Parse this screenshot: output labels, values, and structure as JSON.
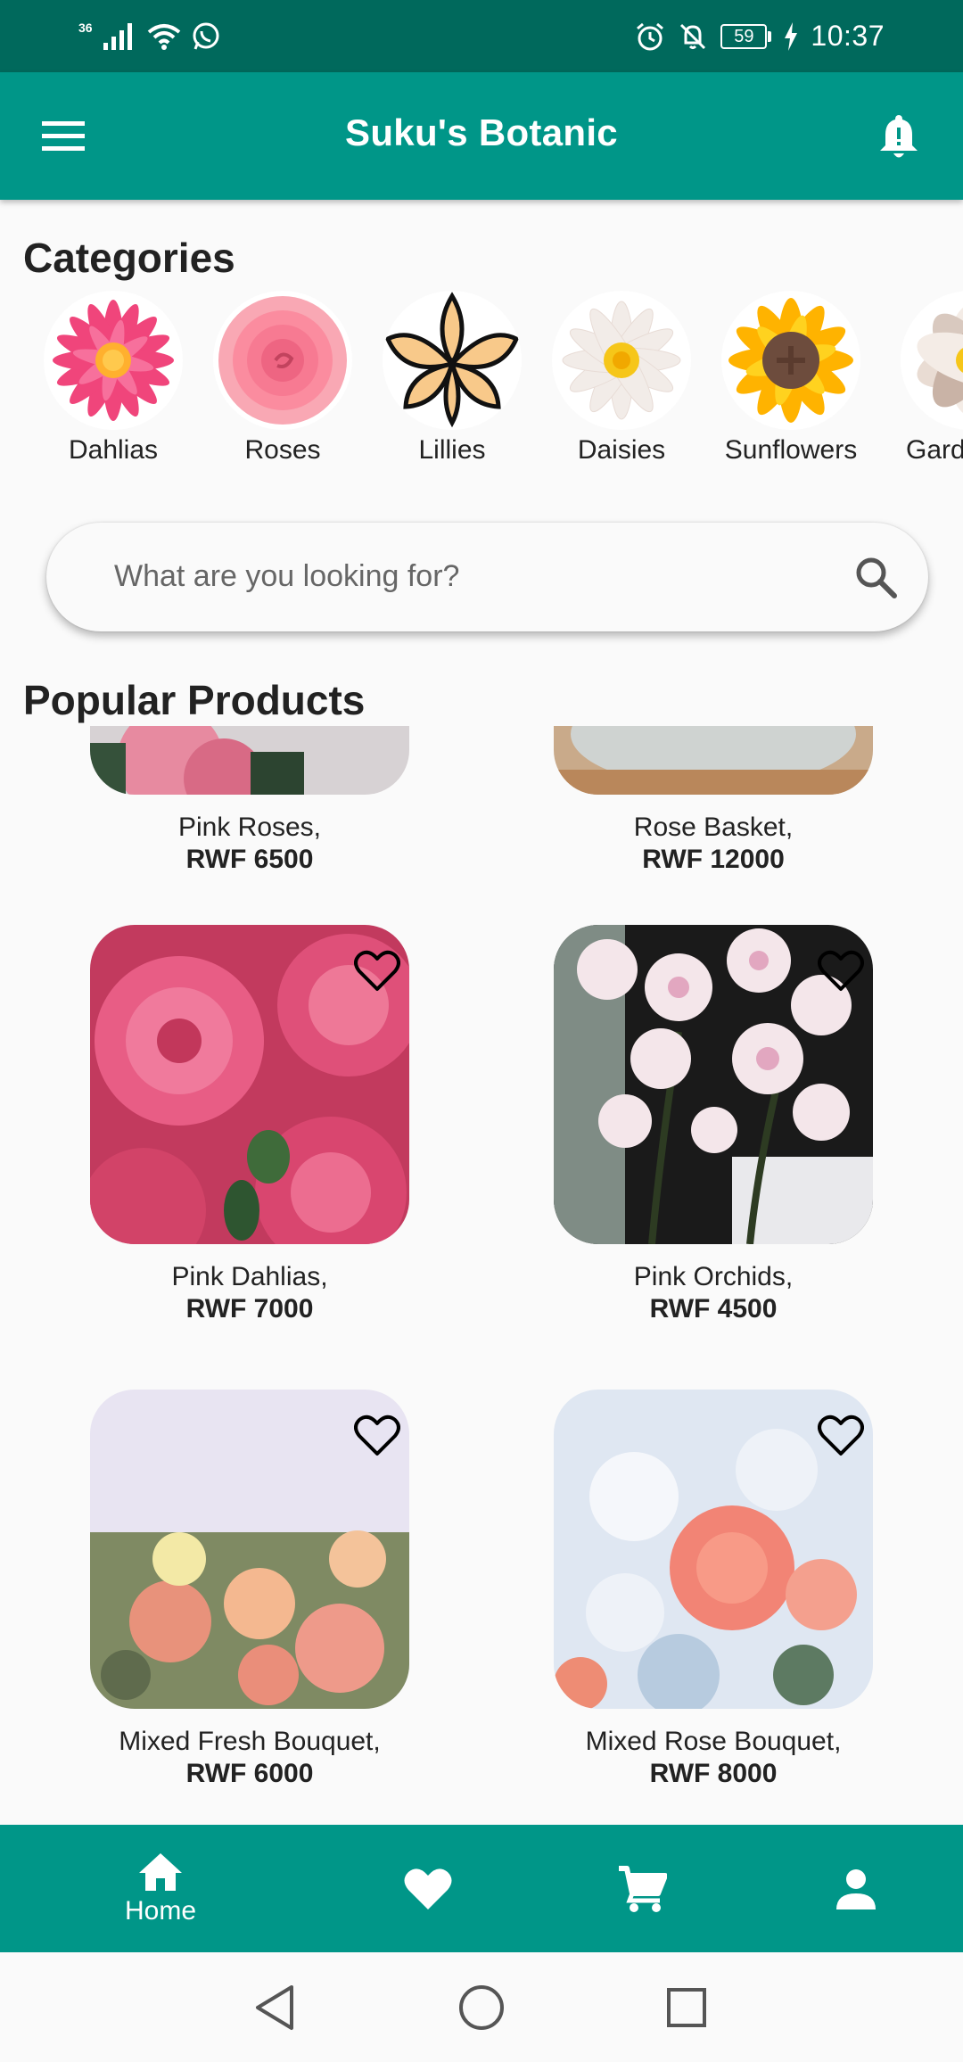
{
  "status_bar": {
    "network": "36",
    "battery": "59",
    "time": "10:37"
  },
  "app_bar": {
    "title": "Suku's Botanic"
  },
  "categories": {
    "title": "Categories",
    "items": [
      {
        "label": "Dahlias",
        "icon": "dahlia-icon"
      },
      {
        "label": "Roses",
        "icon": "rose-icon"
      },
      {
        "label": "Lillies",
        "icon": "lily-icon"
      },
      {
        "label": "Daisies",
        "icon": "daisy-icon"
      },
      {
        "label": "Sunflowers",
        "icon": "sunflower-icon"
      },
      {
        "label": "Gard",
        "icon": "gardenia-icon"
      }
    ]
  },
  "search": {
    "placeholder": "What are you looking for?"
  },
  "popular": {
    "title": "Popular Products",
    "items": [
      {
        "name": "Pink Roses,",
        "price": "RWF 6500"
      },
      {
        "name": "Rose Basket,",
        "price": "RWF 12000"
      },
      {
        "name": "Pink Dahlias,",
        "price": "RWF 7000"
      },
      {
        "name": "Pink Orchids,",
        "price": "RWF 4500"
      },
      {
        "name": "Mixed Fresh Bouquet,",
        "price": "RWF 6000"
      },
      {
        "name": "Mixed Rose Bouquet,",
        "price": "RWF 8000"
      }
    ]
  },
  "bottom_nav": {
    "items": [
      {
        "label": "Home",
        "icon": "home-icon",
        "active": true
      },
      {
        "label": "",
        "icon": "heart-icon",
        "active": false
      },
      {
        "label": "",
        "icon": "cart-icon",
        "active": false
      },
      {
        "label": "",
        "icon": "person-icon",
        "active": false
      }
    ]
  },
  "colors": {
    "status_bar": "#00695c",
    "primary": "#009688",
    "background": "#fafafa"
  }
}
